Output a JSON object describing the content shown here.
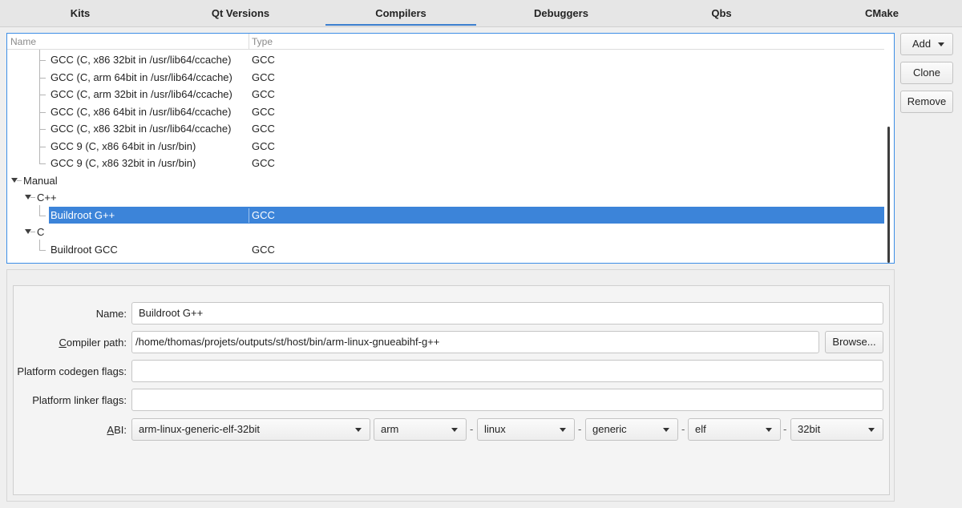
{
  "tabs": [
    {
      "label": "Kits"
    },
    {
      "label": "Qt Versions"
    },
    {
      "label": "Compilers"
    },
    {
      "label": "Debuggers"
    },
    {
      "label": "Qbs"
    },
    {
      "label": "CMake"
    }
  ],
  "active_tab": "Compilers",
  "tree": {
    "headers": {
      "name": "Name",
      "type": "Type"
    },
    "rows": [
      {
        "name": "GCC (C, x86 32bit in /usr/lib64/ccache)",
        "type": "GCC"
      },
      {
        "name": "GCC (C, arm 64bit in /usr/lib64/ccache)",
        "type": "GCC"
      },
      {
        "name": "GCC (C, arm 32bit in /usr/lib64/ccache)",
        "type": "GCC"
      },
      {
        "name": "GCC (C, x86 64bit in /usr/lib64/ccache)",
        "type": "GCC"
      },
      {
        "name": "GCC (C, x86 32bit in /usr/lib64/ccache)",
        "type": "GCC"
      },
      {
        "name": "GCC 9 (C, x86 64bit in /usr/bin)",
        "type": "GCC"
      },
      {
        "name": "GCC 9 (C, x86 32bit in /usr/bin)",
        "type": "GCC"
      },
      {
        "name": "Manual",
        "type": ""
      },
      {
        "name": "C++",
        "type": ""
      },
      {
        "name": "Buildroot G++",
        "type": "GCC"
      },
      {
        "name": "C",
        "type": ""
      },
      {
        "name": "Buildroot GCC",
        "type": "GCC"
      }
    ]
  },
  "buttons": {
    "add": "Add",
    "clone": "Clone",
    "remove": "Remove",
    "browse": "Browse..."
  },
  "form": {
    "name_label": "Name:",
    "name_value": "Buildroot G++",
    "compiler_path_label": "Compiler path:",
    "compiler_path_value": "/home/thomas/projets/outputs/st/host/bin/arm-linux-gnueabihf-g++",
    "codegen_label": "Platform codegen flags:",
    "codegen_value": "",
    "linker_label": "Platform linker flags:",
    "linker_value": "",
    "abi_label": "ABI:",
    "abi": {
      "full": "arm-linux-generic-elf-32bit",
      "arch": "arm",
      "os": "linux",
      "flavor": "generic",
      "format": "elf",
      "width": "32bit",
      "separator": "-"
    }
  },
  "colors": {
    "accent": "#3d8ee6",
    "selection": "#3c84d9"
  }
}
